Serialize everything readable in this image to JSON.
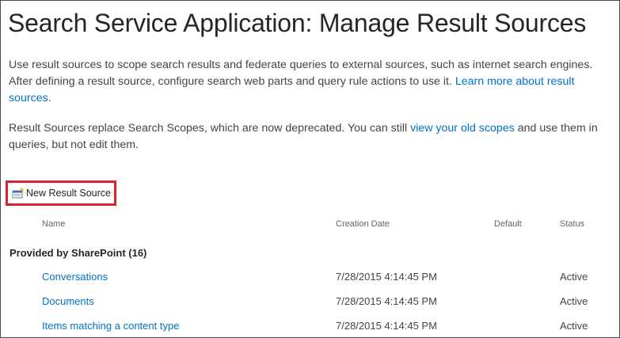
{
  "page": {
    "title": "Search Service Application: Manage Result Sources"
  },
  "description": {
    "para1_text": "Use result sources to scope search results and federate queries to external sources, such as internet search engines. After defining a result source, configure search web parts and query rule actions to use it. ",
    "para1_link": "Learn more about result sources",
    "para1_end": ".",
    "para2_text": "Result Sources replace Search Scopes, which are now deprecated. You can still ",
    "para2_link": "view your old scopes",
    "para2_end": " and use them in queries, but not edit them."
  },
  "toolbar": {
    "new_result_source_label": "New Result Source",
    "new_icon": "new-item-icon",
    "highlight_color": "#d9232e"
  },
  "columns": {
    "name": "Name",
    "creation_date": "Creation Date",
    "default": "Default",
    "status": "Status"
  },
  "group": {
    "label": "Provided by SharePoint (16)"
  },
  "rows": [
    {
      "name": "Conversations",
      "creation_date": "7/28/2015 4:14:45 PM",
      "default": "",
      "status": "Active"
    },
    {
      "name": "Documents",
      "creation_date": "7/28/2015 4:14:45 PM",
      "default": "",
      "status": "Active"
    },
    {
      "name": "Items matching a content type",
      "creation_date": "7/28/2015 4:14:45 PM",
      "default": "",
      "status": "Active"
    }
  ],
  "colors": {
    "link": "#0072c6",
    "text": "#444444",
    "title": "#262626"
  }
}
